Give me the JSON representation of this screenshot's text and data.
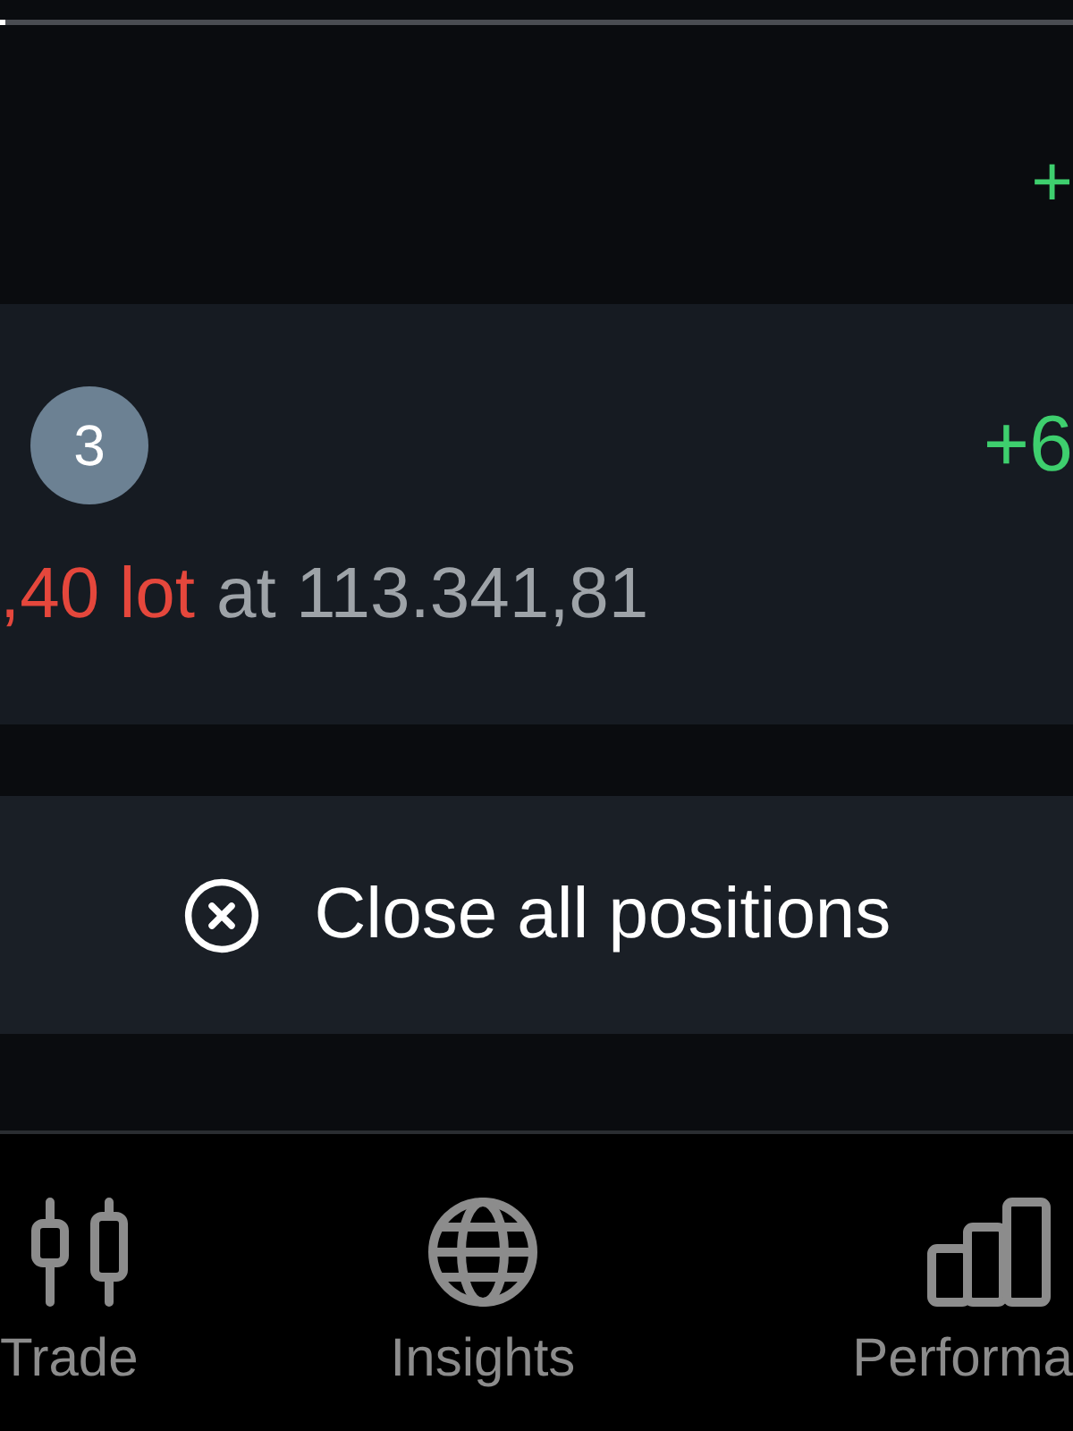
{
  "summary": {
    "profit": "+"
  },
  "position": {
    "count": "3",
    "profit": "+6",
    "volume": ",40 lot",
    "price_text": "at 113.341,81"
  },
  "close_all_button": {
    "label": "Close all positions"
  },
  "tab_bar": [
    {
      "label": "Trade",
      "kind": "candles",
      "selected": false
    },
    {
      "label": "Insights",
      "kind": "globe",
      "selected": false
    },
    {
      "label": "Performa",
      "kind": "bars",
      "selected": false
    }
  ]
}
